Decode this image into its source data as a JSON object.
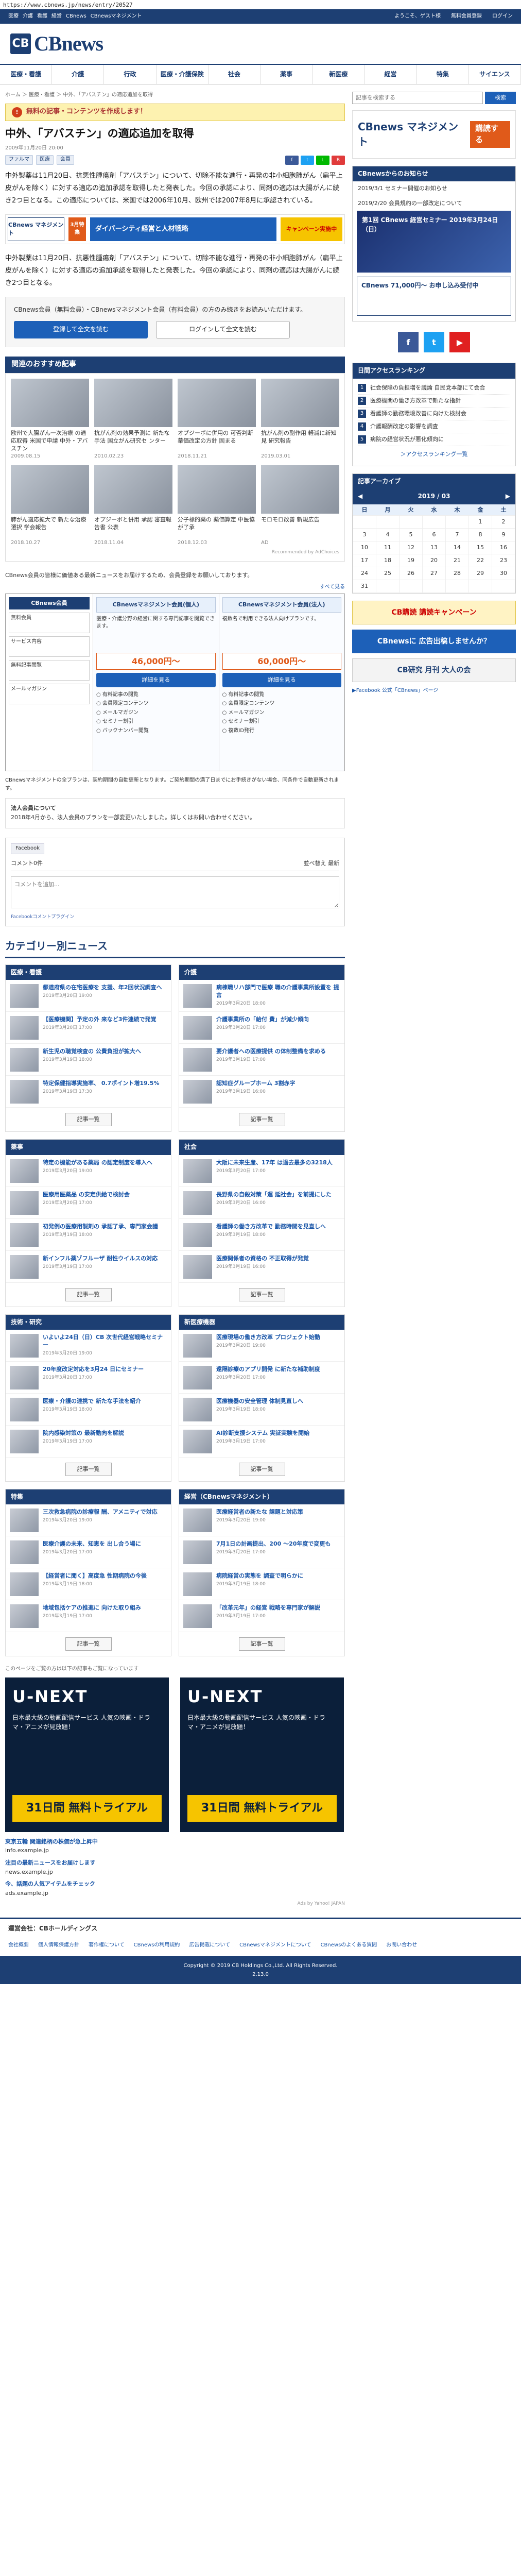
{
  "url": "https://www.cbnews.jp/news/entry/20527",
  "topbar": {
    "left": [
      "医療",
      "介護",
      "看護",
      "経営",
      "CBnews",
      "CBnewsマネジメント"
    ],
    "right": [
      "ようこそ、ゲスト様",
      "無料会員登録",
      "ログイン"
    ]
  },
  "logo": {
    "mark": "CB",
    "text": "CBnews"
  },
  "search": {
    "placeholder": "記事を検索する",
    "button": "検索"
  },
  "nav": [
    "医療・看護",
    "介護",
    "行政",
    "医療・介護保険",
    "社会",
    "薬事",
    "新医療",
    "経営",
    "特集",
    "サイエンス"
  ],
  "breadcrumb": "ホーム ＞ 医療・看護 ＞ 中外、「アバスチン」の適応追加を取得",
  "alert": {
    "icon": "!",
    "text": "無料の記事・コンテンツを作成します！"
  },
  "article": {
    "title": "中外、「アバスチン」の適応追加を取得",
    "date": "2009年11月20日 20:00",
    "tags": [
      "ファルマ",
      "医療",
      "会員"
    ],
    "p1": "中外製薬は11月20日、抗悪性腫瘍剤「アバスチン」について、切除不能な進行・再発の非小細胞肺がん（扁平上皮がんを除く）に対する適応の追加承認を取得したと発表した。今回の承認により、同剤の適応は大腸がんに続き2つ目となる。この適応については、米国では2006年10月、欧州では2007年8月に承認されている。",
    "p2": "中外製薬は11月20日、抗悪性腫瘍剤「アバスチン」について、切除不能な進行・再発の非小細胞肺がん（扁平上皮がんを除く）に対する適応の追加承認を取得したと発表した。今回の承認により、同剤の適応は大腸がんに続き2つ目となる。",
    "ad": {
      "a1": "CBnews マネジメント",
      "a2": "3月特集",
      "a3": "ダイバーシティ経営と人材戦略",
      "a4": "キャンペーン実施中"
    },
    "paywall": "CBnews会員（無料会員）・CBnewsマネジメント会員（有料会員）の方のみ続きをお読みいただけます。",
    "pw_btn1": "登録して全文を読む",
    "pw_btn2": "ログインして全文を読む"
  },
  "reco": {
    "title": "関連のおすすめ記事",
    "items": [
      {
        "t": "欧州で大腸がん一次治療 の適応取得 米国で申請 中外・アバスチン",
        "d": "2009.08.15"
      },
      {
        "t": "抗がん剤の効果予測に 新たな手法 国立がん研究セ ンター",
        "d": "2010.02.23"
      },
      {
        "t": "オプジーボに併用の 可否判断 薬価改定の方針 固まる",
        "d": "2018.11.21"
      },
      {
        "t": "抗がん剤の副作用 軽減に新知見 研究報告",
        "d": "2019.03.01"
      },
      {
        "t": "肺がん適応拡大で 新たな治療選択 学会報告",
        "d": "2018.10.27"
      },
      {
        "t": "オプジーボと併用 承認 審査報告書 公表",
        "d": "2018.11.04"
      },
      {
        "t": "分子標的薬の 薬価算定 中医協が了承",
        "d": "2018.12.03"
      },
      {
        "t": "モロモロ改善 新規広告",
        "d": "AD"
      }
    ],
    "adchoices": "Recommended by AdChoices"
  },
  "plans": {
    "note": "CBnews会員の皆様に価値ある最新ニュースをお届けするため、会員登録をお願いしております。",
    "heading": "すべて見る",
    "left_title": "CBnews会員",
    "left_boxes": [
      "無料会員",
      "サービス内容",
      "無料記事閲覧",
      "メールマガジン"
    ],
    "cols": [
      {
        "title": "CBnewsマネジメント会員(個人)",
        "desc": "医療・介護分野の経営に関する専門記事を閲覧できます。",
        "price": "46,000円〜",
        "btn": "詳細を見る",
        "svc": "○ 有料記事の閲覧\n○ 会員限定コンテンツ\n○ メールマガジン\n○ セミナー割引\n○ バックナンバー閲覧"
      },
      {
        "title": "CBnewsマネジメント会員(法人)",
        "desc": "複数名で利用できる法人向けプランです。",
        "price": "60,000円〜",
        "btn": "詳細を見る",
        "svc": "○ 有料記事の閲覧\n○ 会員限定コンテンツ\n○ メールマガジン\n○ セミナー割引\n○ 複数ID発行"
      }
    ],
    "foot": "CBnewsマネジメントの全プランは、契約期間の自動更新となります。ご契約期間の満了日までにお手続きがない場合、同条件で自動更新されます。"
  },
  "notice": {
    "title": "法人会員について",
    "text": "2018年4月から、法人会員のプランを一部変更いたしました。詳しくはお問い合わせください。"
  },
  "comments": {
    "fb": "Facebook",
    "count": "コメント0件",
    "sort": "並べ替え 最新",
    "placeholder": "コメントを追加...",
    "plugin": "Facebookコメントプラグイン"
  },
  "categories": {
    "title": "カテゴリー別ニュース",
    "more": "記事一覧",
    "list": [
      {
        "name": "医療・看護",
        "items": [
          {
            "t": "都道府県の在宅医療を 支援、年2回状況調査へ",
            "d": "2019年3月20日 19:00"
          },
          {
            "t": "【医療機関】予定の外 来など3件連続で発覚",
            "d": "2019年3月20日 17:00"
          },
          {
            "t": "新生児の聴覚検査の 公費負担が拡大へ",
            "d": "2019年3月19日 18:00"
          },
          {
            "t": "特定保健指導実施率、 0.7ポイント増19.5%",
            "d": "2019年3月19日 17:30"
          }
        ]
      },
      {
        "name": "介護",
        "items": [
          {
            "t": "病棟職リハ部門で医療 職の介護事業所設置を 提言",
            "d": "2019年3月20日 18:00"
          },
          {
            "t": "介護事業所の「給付 費」が減少傾向",
            "d": "2019年3月20日 17:00"
          },
          {
            "t": "要介護者への医療提供 の体制整備を求める",
            "d": "2019年3月19日 17:00"
          },
          {
            "t": "認知症グループホーム 3割赤字",
            "d": "2019年3月19日 16:00"
          }
        ]
      },
      {
        "name": "薬事",
        "items": [
          {
            "t": "特定の機能がある薬局 の認定制度を導入へ",
            "d": "2019年3月20日 19:00"
          },
          {
            "t": "医療用医薬品 の安定供給で検討会",
            "d": "2019年3月20日 17:00"
          },
          {
            "t": "初発例の医療用製剤の 承認了承、専門家会議",
            "d": "2019年3月19日 18:00"
          },
          {
            "t": "新インフル薬ゾフルーザ 耐性ウイルスの対応",
            "d": "2019年3月19日 17:00"
          }
        ]
      },
      {
        "name": "社会",
        "items": [
          {
            "t": "大阪に未来生産、17年 は過去最多の3218人",
            "d": "2019年3月20日 17:00"
          },
          {
            "t": "長野県の自殺対策「遅 延社会」を前提にした",
            "d": "2019年3月20日 16:00"
          },
          {
            "t": "看護師の働き方改革で 勤務時間を見直しへ",
            "d": "2019年3月19日 18:00"
          },
          {
            "t": "医療関係者の資格の 不正取得が発覚",
            "d": "2019年3月19日 16:00"
          }
        ]
      },
      {
        "name": "技術・研究",
        "items": [
          {
            "t": "いよいよ24日（日）CB 次世代経営戦略セミナー",
            "d": "2019年3月20日 19:00"
          },
          {
            "t": "20年度改定対応を3月24 日にセミナー",
            "d": "2019年3月20日 17:00"
          },
          {
            "t": "医療・介護の連携で 新たな手法を紹介",
            "d": "2019年3月19日 18:00"
          },
          {
            "t": "院内感染対策の 最新動向を解説",
            "d": "2019年3月19日 17:00"
          }
        ]
      },
      {
        "name": "新医療機器",
        "items": [
          {
            "t": "医療現場の働き方改革 プロジェクト始動",
            "d": "2019年3月20日 19:00"
          },
          {
            "t": "遠隔診療のアプリ開発 に新たな補助制度",
            "d": "2019年3月20日 17:00"
          },
          {
            "t": "医療機器の安全管理 体制見直しへ",
            "d": "2019年3月19日 18:00"
          },
          {
            "t": "AI診断支援システム 実証実験を開始",
            "d": "2019年3月19日 17:00"
          }
        ]
      },
      {
        "name": "特集",
        "items": [
          {
            "t": "三次救急病院の診療報 酬、アメニティで対応",
            "d": "2019年3月20日 19:00"
          },
          {
            "t": "医療介護の未来、知恵を 出し合う場に",
            "d": "2019年3月20日 17:00"
          },
          {
            "t": "【経営者に聞く】高度急 性期病院の今後",
            "d": "2019年3月19日 18:00"
          },
          {
            "t": "地域包括ケアの推進に 向けた取り組み",
            "d": "2019年3月19日 17:00"
          }
        ]
      },
      {
        "name": "経営（CBnewsマネジメント）",
        "items": [
          {
            "t": "医療経営者の新たな 課題と対応策",
            "d": "2019年3月20日 19:00"
          },
          {
            "t": "7月1日の計画提出、200 〜20年度で変更も",
            "d": "2019年3月20日 17:00"
          },
          {
            "t": "病院経営の実態を 調査で明らかに",
            "d": "2019年3月19日 18:00"
          },
          {
            "t": "「改革元年」の経営 戦略を専門家が解説",
            "d": "2019年3月19日 17:00"
          }
        ]
      }
    ]
  },
  "bottom_ad_label": "このページをご覧の方は以下の記事もご覧になっています",
  "unext": {
    "brand": "U-NEXT",
    "line": "日本最大級の動画配信サービス 人気の映画・ドラマ・アニメが見放題！",
    "cta": "31日間 無料トライアル"
  },
  "adtexts": [
    {
      "title": "東京五輪 関連銘柄の株価が急上昇中",
      "src": "info.example.jp"
    },
    {
      "title": "注目の最新ニュースをお届けします",
      "src": "news.example.jp"
    },
    {
      "title": "今、話題の人気アイテムをチェック",
      "src": "ads.example.jp"
    }
  ],
  "adby": "Ads by Yahoo! JAPAN",
  "side": {
    "ad_cbm": {
      "title": "CBnews マネジメント",
      "cta": "購読する"
    },
    "info_title": "CBnewsからのお知らせ",
    "info": [
      "2019/3/1 セミナー開催のお知らせ",
      "2019/2/20 会員規約の一部改定について"
    ],
    "sad1": "第1回 CBnews 経営セミナー 2019年3月24日（日）",
    "sad2": "CBnews 71,000円〜 お申し込み受付中",
    "social": [
      "f",
      "t",
      "▶"
    ],
    "rank_title": "日間アクセスランキング",
    "rank": [
      "社会保障の負担増を議論 自民党本部にて会合",
      "医療機関の働き方改革で新たな指針",
      "看護師の勤務環境改善に向けた検討会",
      "介護報酬改定の影響を調査",
      "病院の経営状況が悪化傾向に"
    ],
    "rank_more": "＞アクセスランキング一覧",
    "cal_title": "記事アーカイブ",
    "cal_month": "2019 / 03",
    "cal_days": [
      "日",
      "月",
      "火",
      "水",
      "木",
      "金",
      "土"
    ],
    "cal_weeks": [
      [
        "",
        "",
        "",
        "",
        "",
        "1",
        "2"
      ],
      [
        "3",
        "4",
        "5",
        "6",
        "7",
        "8",
        "9"
      ],
      [
        "10",
        "11",
        "12",
        "13",
        "14",
        "15",
        "16"
      ],
      [
        "17",
        "18",
        "19",
        "20",
        "21",
        "22",
        "23"
      ],
      [
        "24",
        "25",
        "26",
        "27",
        "28",
        "29",
        "30"
      ],
      [
        "31",
        "",
        "",
        "",
        "",
        "",
        ""
      ]
    ],
    "ban1": "CB購読 講読キャンペーン",
    "ban2": "CBnewsに 広告出稿しませんか？",
    "ban3": "CB研究 月刊 大人の会",
    "sidelink": "▶Facebook 公式「CBnews」ページ"
  },
  "footer": {
    "company": "運営会社：CBホールディングス",
    "links": [
      "会社概要",
      "個人情報保護方針",
      "著作権について",
      "CBnewsの利用規約",
      "広告掲載について",
      "CBnewsマネジメントについて",
      "CBnewsのよくある質問",
      "お問い合わせ"
    ],
    "copyright": "Copyright © 2019 CB Holdings Co.,Ltd. All Rights Reserved.",
    "ver": "2.13.0"
  }
}
